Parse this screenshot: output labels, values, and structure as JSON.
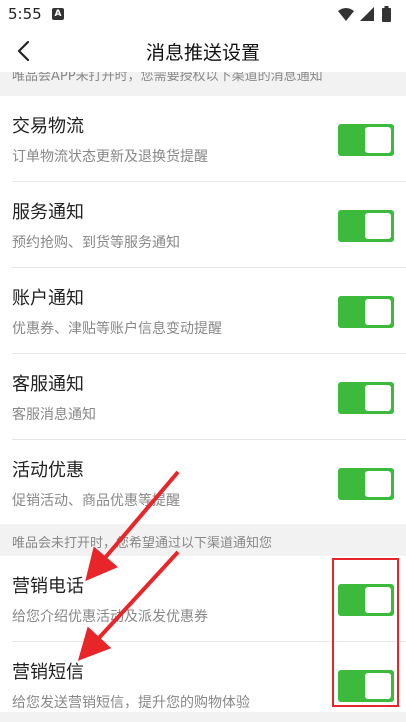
{
  "status_bar": {
    "time": "5:55",
    "notification_icon": "A"
  },
  "nav": {
    "title": "消息推送设置",
    "back_icon": "chevron-left-icon"
  },
  "partial_hint": "唯品会APP未打开时，您需要授权以下渠道的消息通知",
  "app_settings": [
    {
      "title": "交易物流",
      "subtitle": "订单物流状态更新及退换货提醒",
      "enabled": true
    },
    {
      "title": "服务通知",
      "subtitle": "预约抢购、到货等服务通知",
      "enabled": true
    },
    {
      "title": "账户通知",
      "subtitle": "优惠券、津贴等账户信息变动提醒",
      "enabled": true
    },
    {
      "title": "客服通知",
      "subtitle": "客服消息通知",
      "enabled": true
    },
    {
      "title": "活动优惠",
      "subtitle": "促销活动、商品优惠等提醒",
      "enabled": true
    }
  ],
  "section_hint": "唯品会未打开时，您希望通过以下渠道通知您",
  "channel_settings": [
    {
      "title": "营销电话",
      "subtitle": "给您介绍优惠活动及派发优惠券",
      "enabled": true
    },
    {
      "title": "营销短信",
      "subtitle": "给您发送营销短信，提升您的购物体验",
      "enabled": true
    }
  ],
  "colors": {
    "toggle_on": "#3cba3c",
    "highlight": "#e8262a",
    "arrow": "#e8262a"
  }
}
